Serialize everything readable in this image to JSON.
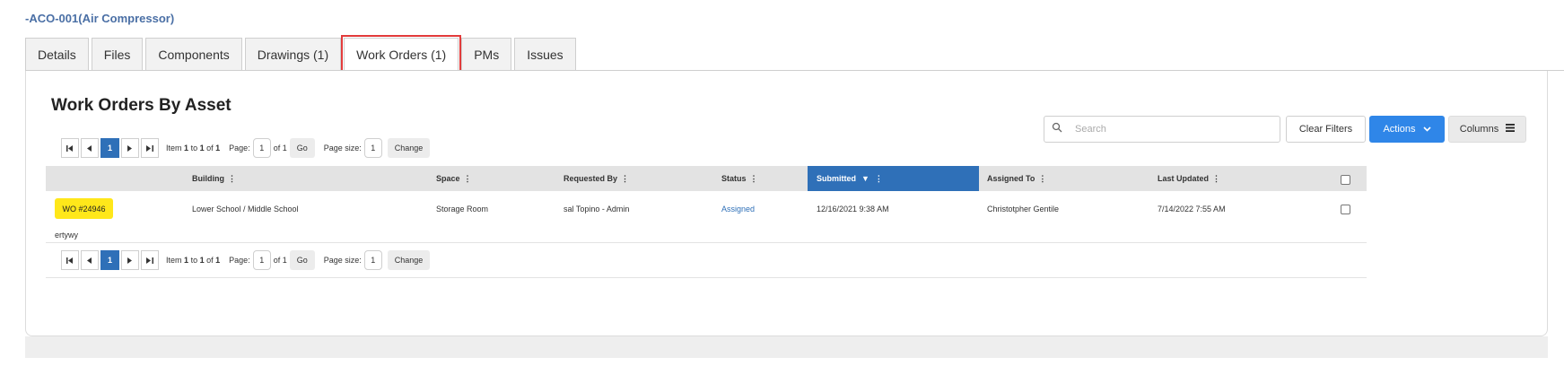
{
  "asset_title": "-ACO-001(Air Compressor)",
  "tabs": [
    {
      "label": "Details"
    },
    {
      "label": "Files"
    },
    {
      "label": "Components"
    },
    {
      "label": "Drawings (1)"
    },
    {
      "label": "Work Orders (1)",
      "active": true
    },
    {
      "label": "PMs"
    },
    {
      "label": "Issues"
    }
  ],
  "panel": {
    "title": "Work Orders By Asset",
    "search_placeholder": "Search",
    "clear_filters": "Clear Filters",
    "actions": "Actions",
    "columns": "Columns"
  },
  "pager": {
    "current_page": "1",
    "item_prefix": "Item",
    "item_from": "1",
    "item_to_word": "to",
    "item_to": "1",
    "item_of_word": "of",
    "item_total": "1",
    "page_label": "Page:",
    "page_value": "1",
    "page_of": "of 1",
    "go": "Go",
    "page_size_label": "Page size:",
    "page_size_value": "1",
    "change": "Change"
  },
  "table": {
    "headers": {
      "building": "Building",
      "space": "Space",
      "requested_by": "Requested By",
      "status": "Status",
      "submitted": "Submitted",
      "assigned_to": "Assigned To",
      "last_updated": "Last Updated"
    },
    "row": {
      "wo": "WO #24946",
      "building": "Lower School / Middle School",
      "space": "Storage Room",
      "requested_by": "sal Topino - Admin",
      "status": "Assigned",
      "submitted": "12/16/2021 9:38 AM",
      "assigned_to": "Christotpher Gentile",
      "last_updated": "7/14/2022 7:55 AM",
      "description": "ertywy"
    }
  },
  "colors": {
    "accent": "#2f70b8",
    "button_blue": "#2f86e8",
    "wo_badge": "#ffe71a",
    "highlight": "#e23b3b"
  }
}
